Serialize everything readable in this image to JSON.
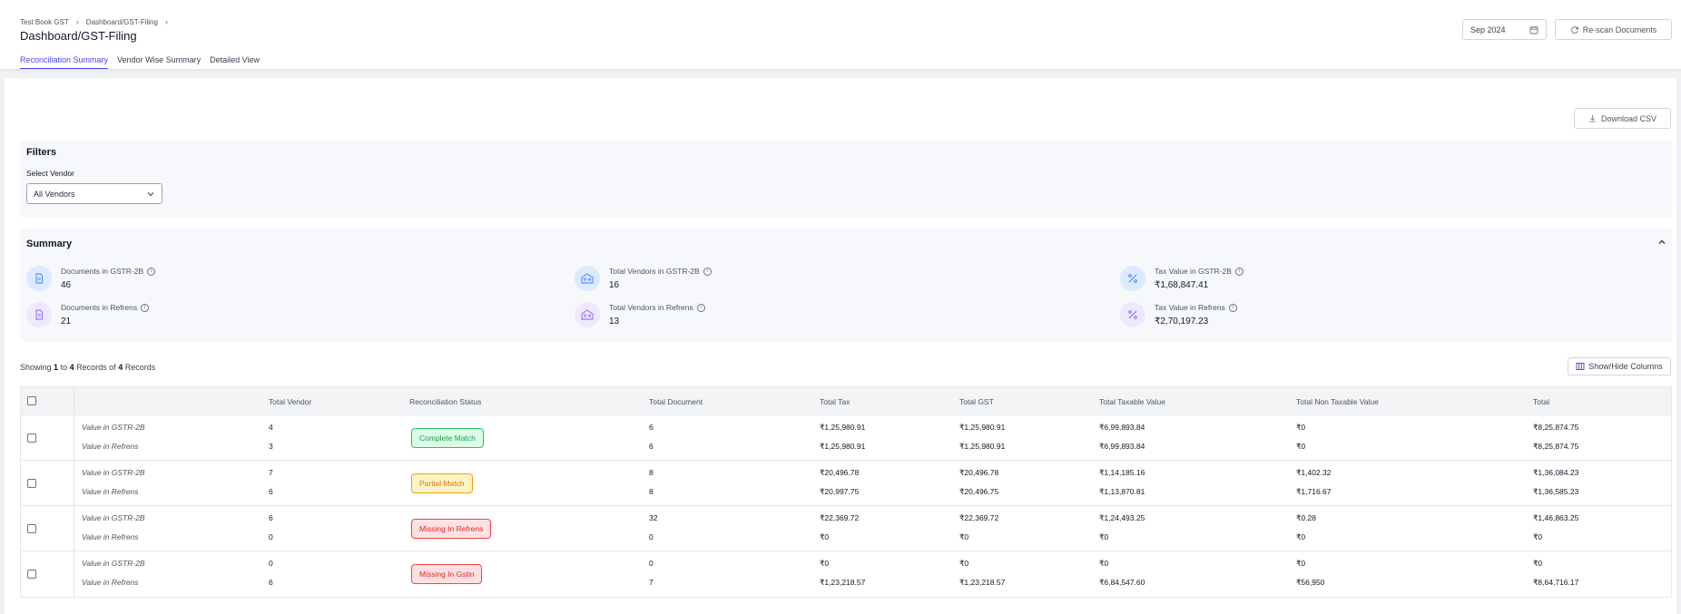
{
  "header": {
    "breadcrumb": [
      "Test Book GST",
      "Dashboard/GST-Filing"
    ],
    "title": "Dashboard/GST-Filing",
    "tabs": [
      {
        "label": "Reconciliation Summary",
        "active": true
      },
      {
        "label": "Vendor Wise Summary",
        "active": false
      },
      {
        "label": "Detailed View",
        "active": false
      }
    ],
    "period": "Sep 2024",
    "rescan_label": "Re-scan Documents"
  },
  "download_csv_label": "Download CSV",
  "filters": {
    "title": "Filters",
    "vendor_label": "Select Vendor",
    "vendor_value": "All Vendors"
  },
  "summary": {
    "title": "Summary",
    "stats": [
      {
        "label": "Documents in GSTR-2B",
        "value": "46",
        "icon": "document-icon",
        "tone": "blue"
      },
      {
        "label": "Total Vendors in GSTR-2B",
        "value": "16",
        "icon": "vendors-icon",
        "tone": "blue"
      },
      {
        "label": "Tax Value in GSTR-2B",
        "value": "₹1,68,847.41",
        "icon": "percent-icon",
        "tone": "blue"
      },
      {
        "label": "Documents in Refrens",
        "value": "21",
        "icon": "document-icon",
        "tone": "purple"
      },
      {
        "label": "Total Vendors in Refrens",
        "value": "13",
        "icon": "vendors-icon",
        "tone": "purple"
      },
      {
        "label": "Tax Value in Refrens",
        "value": "₹2,70,197.23",
        "icon": "percent-icon",
        "tone": "purple"
      }
    ]
  },
  "records": {
    "prefix": "Showing",
    "from": "1",
    "to_word": "to",
    "to": "4",
    "records_of": "Records of",
    "total": "4",
    "suffix": "Records"
  },
  "show_hide_label": "Show/Hide Columns",
  "table": {
    "columns": [
      "Total Vendor",
      "Reconciliation Status",
      "Total Document",
      "Total Tax",
      "Total GST",
      "Total Taxable Value",
      "Total Non Taxable Value",
      "Total"
    ],
    "rows": [
      {
        "status": "Complete Match",
        "status_type": "complete",
        "lines": [
          {
            "label": "Value in GSTR-2B",
            "vendor": "4",
            "document": "6",
            "tax": "₹1,25,980.91",
            "gst": "₹1,25,980.91",
            "taxable": "₹6,99,893.84",
            "non_taxable": "₹0",
            "total": "₹8,25,874.75"
          },
          {
            "label": "Value in Refrens",
            "vendor": "3",
            "document": "6",
            "tax": "₹1,25,980.91",
            "gst": "₹1,25,980.91",
            "taxable": "₹6,99,893.84",
            "non_taxable": "₹0",
            "total": "₹8,25,874.75"
          }
        ]
      },
      {
        "status": "Partial Match",
        "status_type": "partial",
        "lines": [
          {
            "label": "Value in GSTR-2B",
            "vendor": "7",
            "document": "8",
            "tax": "₹20,496.78",
            "gst": "₹20,496.78",
            "taxable": "₹1,14,185.16",
            "non_taxable": "₹1,402.32",
            "total": "₹1,36,084.23"
          },
          {
            "label": "Value in Refrens",
            "vendor": "6",
            "document": "8",
            "tax": "₹20,997.75",
            "gst": "₹20,496.75",
            "taxable": "₹1,13,870.81",
            "non_taxable": "₹1,716.67",
            "total": "₹1,36,585.23"
          }
        ]
      },
      {
        "status": "Missing In Refrens",
        "status_type": "missing",
        "lines": [
          {
            "label": "Value in GSTR-2B",
            "vendor": "6",
            "document": "32",
            "tax": "₹22,369.72",
            "gst": "₹22,369.72",
            "taxable": "₹1,24,493.25",
            "non_taxable": "₹0.28",
            "total": "₹1,46,863.25"
          },
          {
            "label": "Value in Refrens",
            "vendor": "0",
            "document": "0",
            "tax": "₹0",
            "gst": "₹0",
            "taxable": "₹0",
            "non_taxable": "₹0",
            "total": "₹0"
          }
        ]
      },
      {
        "status": "Missing In Gstin",
        "status_type": "missing",
        "lines": [
          {
            "label": "Value in GSTR-2B",
            "vendor": "0",
            "document": "0",
            "tax": "₹0",
            "gst": "₹0",
            "taxable": "₹0",
            "non_taxable": "₹0",
            "total": "₹0"
          },
          {
            "label": "Value in Refrens",
            "vendor": "6",
            "document": "7",
            "tax": "₹1,23,218.57",
            "gst": "₹1,23,218.57",
            "taxable": "₹6,84,547.60",
            "non_taxable": "₹56,950",
            "total": "₹8,64,716.17"
          }
        ]
      }
    ]
  }
}
